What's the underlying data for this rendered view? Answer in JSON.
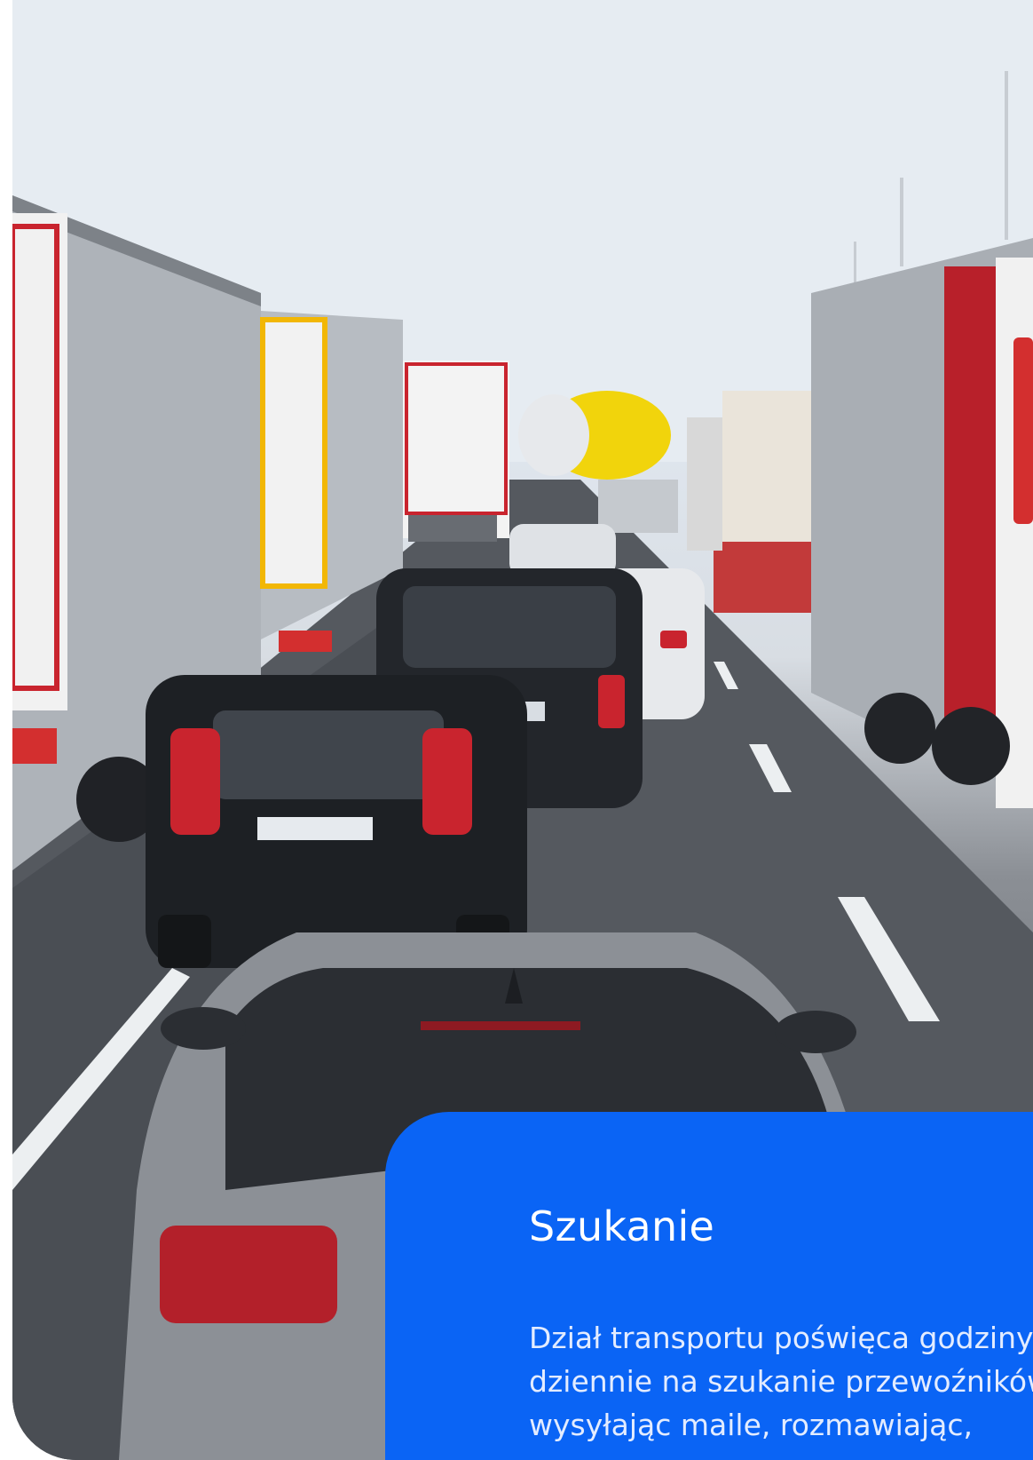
{
  "photo": {
    "subject": "highway traffic jam with trucks and cars"
  },
  "card": {
    "title": "Szukanie",
    "body": "Dział transportu poświęca godziny dziennie na szukanie przewoźników, wysyłając maile, rozmawiając,",
    "background_color": "#0a64f5",
    "text_color": "#ffffff"
  }
}
